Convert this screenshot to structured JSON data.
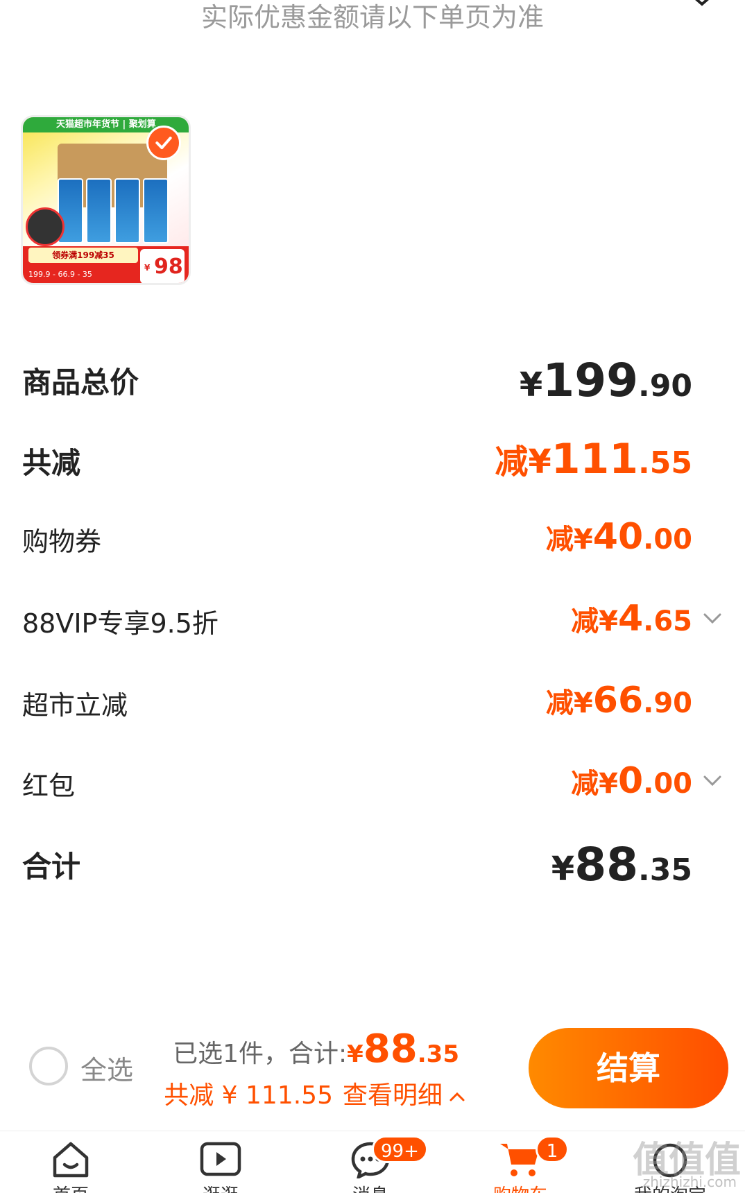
{
  "notice": "实际优惠金额请以下单页为准",
  "product": {
    "banner_text": "天猫超市年货节 | 聚划算",
    "coupon_label": "领券满199减35",
    "strip_values": "199.9 - 66.9 - 35",
    "price_symbol": "¥",
    "price_value": "98"
  },
  "rows": {
    "total": {
      "label": "商品总价",
      "prefix": "¥",
      "int": "199",
      "dec": ".90"
    },
    "discount": {
      "label": "共减",
      "prefix": "减¥",
      "int": "111",
      "dec": ".55"
    },
    "coupon": {
      "label": "购物券",
      "prefix": "减¥",
      "int": "40",
      "dec": ".00"
    },
    "vip": {
      "label": "88VIP专享9.5折",
      "prefix": "减¥",
      "int": "4",
      "dec": ".65"
    },
    "supermarket": {
      "label": "超市立减",
      "prefix": "减¥",
      "int": "66",
      "dec": ".90"
    },
    "redpacket": {
      "label": "红包",
      "prefix": "减¥",
      "int": "0",
      "dec": ".00"
    },
    "sum": {
      "label": "合计",
      "prefix": "¥",
      "int": "88",
      "dec": ".35"
    }
  },
  "bottom": {
    "select_all": "全选",
    "selected_text": "已选1件，合计:",
    "amount_prefix": "¥",
    "amount_int": "88",
    "amount_dec": ".35",
    "reduced_text": "共减 ¥ 111.55",
    "detail_text": "查看明细",
    "checkout_label": "结算"
  },
  "tabbar": {
    "tabs": [
      {
        "label": "首页",
        "icon": "home-icon"
      },
      {
        "label": "逛逛",
        "icon": "video-play-icon"
      },
      {
        "label": "消息",
        "icon": "message-icon",
        "badge": "99+"
      },
      {
        "label": "购物车",
        "icon": "cart-icon",
        "badge": "1",
        "active": true
      },
      {
        "label": "我的淘宝",
        "icon": "profile-icon"
      }
    ]
  },
  "watermark": {
    "main": "值值值",
    "sub": "zhizhizhi.com"
  },
  "colors": {
    "accent": "#ff5000",
    "checkout_start": "#ff8a00",
    "checkout_end": "#ff4d00",
    "text": "#222222",
    "muted": "#9a9a9a"
  }
}
